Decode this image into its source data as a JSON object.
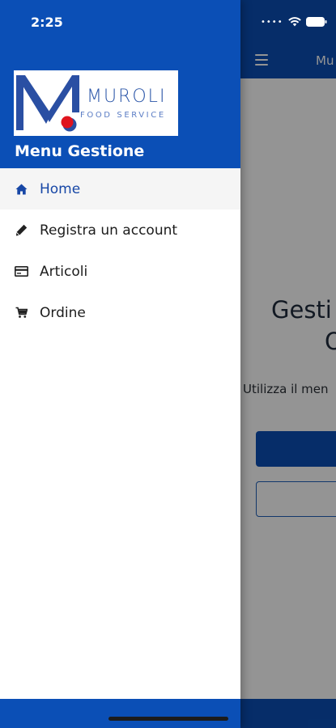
{
  "status_bar": {
    "time": "2:25"
  },
  "drawer": {
    "logo": {
      "name": "MUROLI",
      "tagline": "FOOD SERVICE"
    },
    "menu_title": "Menu Gestione",
    "items": [
      {
        "label": "Home",
        "icon": "home-icon",
        "active": true
      },
      {
        "label": "Registra un account",
        "icon": "pencil-icon",
        "active": false
      },
      {
        "label": "Articoli",
        "icon": "card-icon",
        "active": false
      },
      {
        "label": "Ordine",
        "icon": "cart-icon",
        "active": false
      }
    ]
  },
  "page": {
    "title": "Mu",
    "heading_line1": "Gesti",
    "heading_line2": "O",
    "description": "Utilizza il men"
  },
  "colors": {
    "primary": "#0b4fb6",
    "active_text": "#1747a6",
    "logo_red": "#e0141e"
  }
}
